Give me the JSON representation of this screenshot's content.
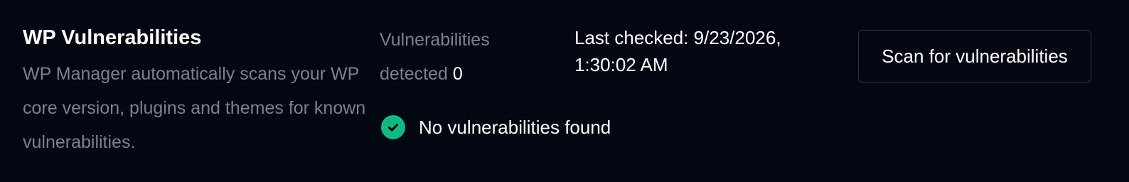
{
  "section": {
    "title": "WP Vulnerabilities",
    "description": "WP Manager automatically scans your WP core version, plugins and themes for known vulnerabilities."
  },
  "stats": {
    "label": "Vulnerabilities detected",
    "count": "0"
  },
  "status": {
    "icon": "check-circle-icon",
    "text": "No vulnerabilities found",
    "color": "#10b981"
  },
  "last_checked": {
    "text": "Last checked: 9/23/2026, 1:30:02 AM"
  },
  "actions": {
    "scan_label": "Scan for vulnerabilities"
  },
  "colors": {
    "background": "#030712",
    "muted_text": "#7a8290",
    "success": "#10b981",
    "button_border": "#2b3340"
  }
}
